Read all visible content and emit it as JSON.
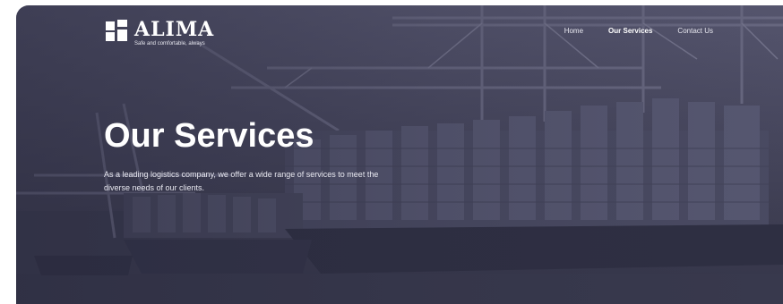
{
  "brand": {
    "name": "ALIMA",
    "tagline": "Safe and comfortable, always"
  },
  "nav": {
    "items": [
      {
        "label": "Home",
        "active": false
      },
      {
        "label": "Our Services",
        "active": true
      },
      {
        "label": "Contact Us",
        "active": false
      }
    ]
  },
  "hero": {
    "title": "Our Services",
    "subtitle": "As a leading logistics company, we offer a wide range of services to meet the diverse needs of our clients."
  },
  "colors": {
    "overlay": "#4b4b62",
    "text": "#ffffff"
  }
}
